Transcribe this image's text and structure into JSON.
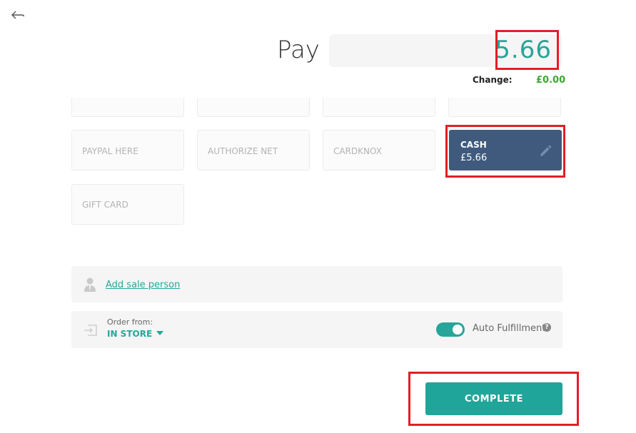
{
  "header": {
    "back_icon": "arrow-left-icon",
    "pay_label": "Pay",
    "pay_amount": "5.66",
    "change_label": "Change:",
    "change_value": "£0.00"
  },
  "payment_methods": {
    "partial_row": [
      "",
      "",
      "",
      ""
    ],
    "items": [
      {
        "label": "PAYPAL HERE"
      },
      {
        "label": "AUTHORIZE NET"
      },
      {
        "label": "CARDKNOX"
      },
      {
        "label": "CASH",
        "amount": "£5.66",
        "selected": true,
        "icon": "pencil-icon"
      },
      {
        "label": "GIFT CARD"
      }
    ]
  },
  "sale_person": {
    "icon": "person-icon",
    "link": "Add sale person"
  },
  "order": {
    "icon": "sign-in-icon",
    "label": "Order from:",
    "value": "IN STORE",
    "auto_fulfillment_label": "Auto Fulfillment",
    "auto_fulfillment_on": true,
    "help": "?"
  },
  "actions": {
    "complete_label": "COMPLETE"
  },
  "colors": {
    "accent": "#26a69a",
    "selected_tile": "#3f5a7d",
    "highlight": "#e31e25",
    "change": "#3aa832"
  }
}
